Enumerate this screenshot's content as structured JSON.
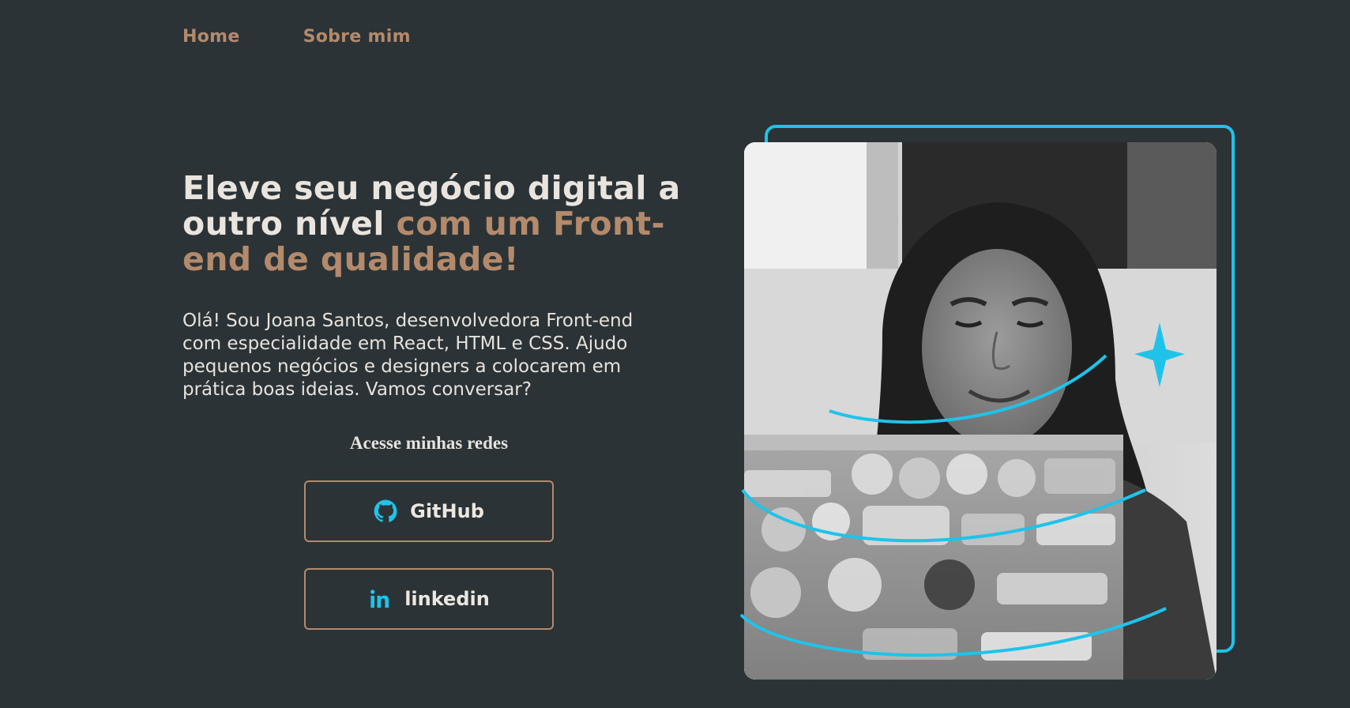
{
  "nav": {
    "home": "Home",
    "about": "Sobre mim"
  },
  "hero": {
    "headline_part1": "Eleve seu negócio digital a outro nível ",
    "headline_part2": "com um Front-end de qualidade!",
    "intro": "Olá! Sou Joana Santos, desenvolvedora Front-end com especialidade em React, HTML e CSS. Ajudo pequenos negócios e designers a colocarem em prática boas ideias. Vamos conversar?",
    "socials_title": "Acesse minhas redes"
  },
  "socials": {
    "github_label": "GitHub",
    "linkedin_label": "linkedin"
  },
  "icons": {
    "github": "github-icon",
    "linkedin": "linkedin-icon",
    "sparkle": "sparkle-icon"
  },
  "colors": {
    "background": "#2b3336",
    "accent": "#b38a6b",
    "frame": "#1fc3ea",
    "text": "#e9e4de"
  }
}
